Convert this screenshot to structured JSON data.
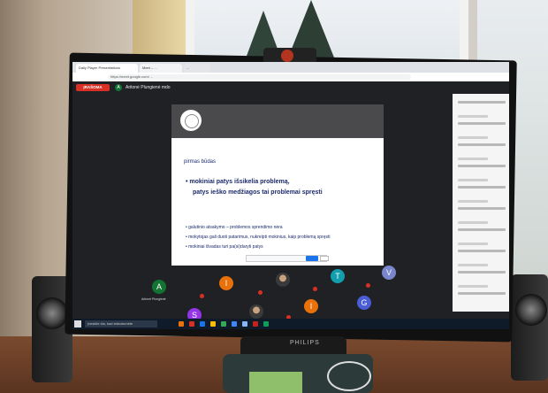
{
  "browser": {
    "tabs": [
      "Daily Player Presentations",
      "Meet – ...",
      "..."
    ],
    "url": "https://meet.google.com/ ..."
  },
  "meet": {
    "recording_label": "ĮRAŠOMA",
    "host_initial": "A",
    "host_name": "Aritonė Plungienė mdo"
  },
  "slide": {
    "heading": "pirmas būdas",
    "bullet_main_line1": "•   mokiniai patys išsikelia problemą,",
    "bullet_main_line2": "patys ieško medžiagos tai problemai spręsti",
    "bullet2": "•   galutinio atsakymo – problemos sprendimo nėra",
    "bullet3": "•   mokytojas gali duoti patarimus, nukreipti mokinius, kaip problemą spręsti",
    "bullet4": "•   mokiniai išvadas turi pa(si)daryti patys"
  },
  "participants": [
    {
      "initial": "A",
      "color": "#137333",
      "name": "Aritonė Plungienė"
    },
    {
      "initial": "I",
      "color": "#e8710a",
      "name": ""
    },
    {
      "initial": "",
      "color": "#5f6368",
      "name": ""
    },
    {
      "initial": "T",
      "color": "#129eaf",
      "name": ""
    },
    {
      "initial": "V",
      "color": "#7986cb",
      "name": ""
    },
    {
      "initial": "S",
      "color": "#9334e6",
      "name": ""
    },
    {
      "initial": "",
      "color": "#5f6368",
      "name": ""
    },
    {
      "initial": "I",
      "color": "#e8710a",
      "name": ""
    },
    {
      "initial": "G",
      "color": "#4a5cd6",
      "name": ""
    }
  ],
  "taskbar": {
    "search_placeholder": "Įveskite čia, kad ieškotumėte"
  },
  "monitor_brand": "PHILIPS"
}
